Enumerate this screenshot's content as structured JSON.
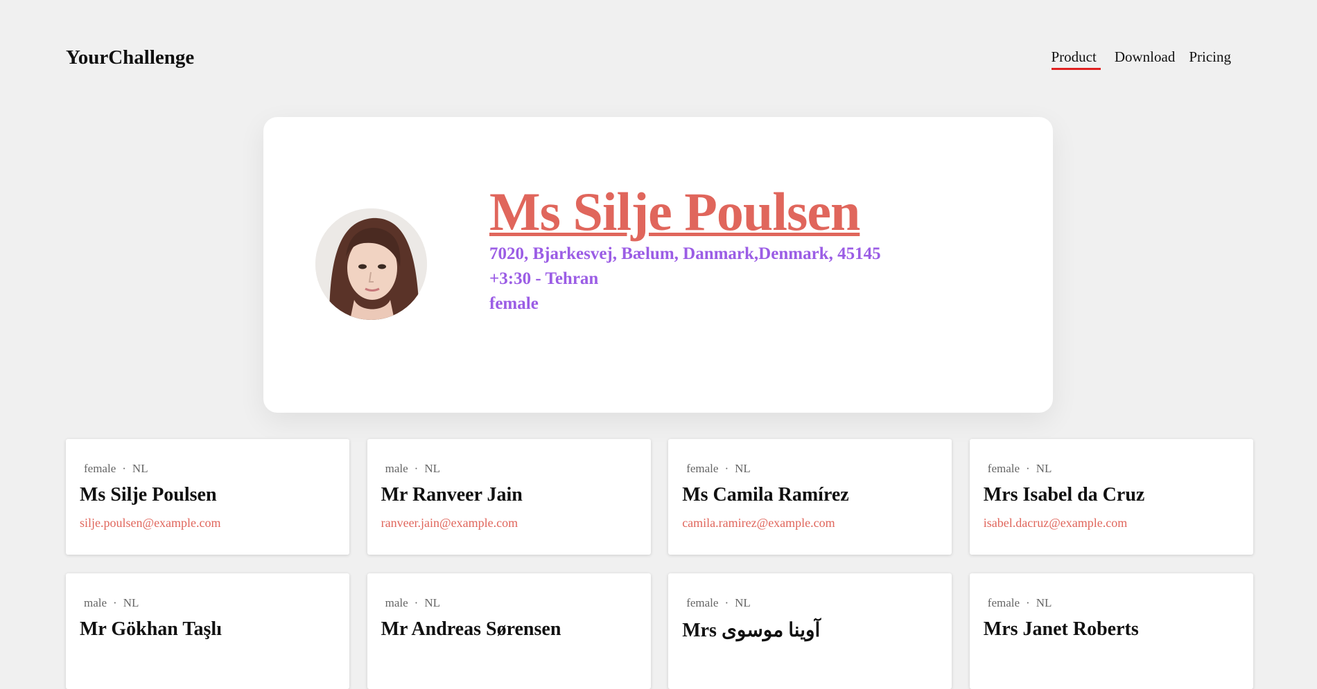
{
  "brand": "YourChallenge",
  "nav": [
    {
      "label": "Product",
      "active": true
    },
    {
      "label": "Download",
      "active": false
    },
    {
      "label": "Pricing",
      "active": false
    }
  ],
  "hero": {
    "name": "Ms Silje Poulsen",
    "address": "7020, Bjarkesvej, Bælum, Danmark,Denmark, 45145",
    "timezone": "+3:30 - Tehran",
    "gender": "female"
  },
  "separator": "·",
  "cards": [
    {
      "gender": "female",
      "nat": "NL",
      "name": "Ms Silje Poulsen",
      "email": "silje.poulsen@example.com"
    },
    {
      "gender": "male",
      "nat": "NL",
      "name": "Mr Ranveer Jain",
      "email": "ranveer.jain@example.com"
    },
    {
      "gender": "female",
      "nat": "NL",
      "name": "Ms Camila Ramírez",
      "email": "camila.ramirez@example.com"
    },
    {
      "gender": "female",
      "nat": "NL",
      "name": "Mrs Isabel da Cruz",
      "email": "isabel.dacruz@example.com"
    },
    {
      "gender": "male",
      "nat": "NL",
      "name": "Mr Gökhan Taşlı",
      "email": ""
    },
    {
      "gender": "male",
      "nat": "NL",
      "name": "Mr Andreas Sørensen",
      "email": ""
    },
    {
      "gender": "female",
      "nat": "NL",
      "name": "Mrs آوینا موسوی",
      "email": ""
    },
    {
      "gender": "female",
      "nat": "NL",
      "name": "Mrs Janet Roberts",
      "email": ""
    }
  ],
  "colors": {
    "accent": "#e0665c",
    "info": "#9b5de5",
    "nav_underline": "#e02020"
  }
}
